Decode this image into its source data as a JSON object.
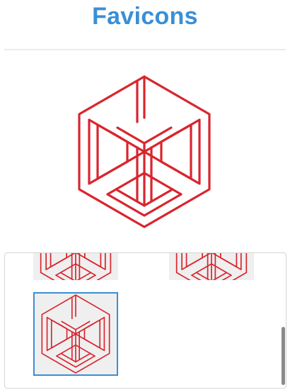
{
  "header": {
    "title": "Favicons"
  },
  "colors": {
    "accent": "#3a8fd6",
    "icon": "#d9252e",
    "thumb_bg": "#efefef"
  },
  "preview": {
    "icon": "impossible-cube-icon"
  },
  "gallery": {
    "items": [
      {
        "icon": "impossible-cube-icon",
        "selected": false
      },
      {
        "icon": "impossible-cube-icon",
        "selected": false
      },
      {
        "icon": "impossible-cube-icon",
        "selected": true
      }
    ]
  }
}
